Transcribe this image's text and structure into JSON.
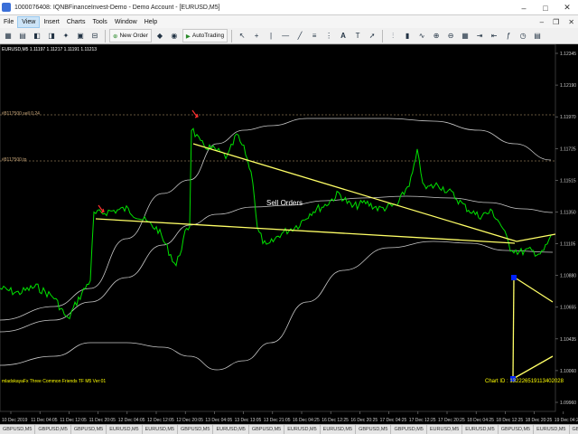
{
  "window": {
    "title": "1000076408: IQNBFinanceInvest-Demo - Demo Account - [EURUSD,M5]",
    "controls": [
      "–",
      "□",
      "✕"
    ]
  },
  "menu": {
    "items": [
      "File",
      "View",
      "Insert",
      "Charts",
      "Tools",
      "Window",
      "Help"
    ],
    "active": "View"
  },
  "toolbar": {
    "new_order": "New Order",
    "auto_trading": "AutoTrading"
  },
  "chart": {
    "symbol_info": "EURUSD,M5  1.11197 1.11217 1.11191 1.11213",
    "sell_level_label": "#8117500 sell 0.24",
    "tp_level_label": "#8117500 tp",
    "annotation": "Sell Orders",
    "indicator_label": "mladskayaFx Three Common Friends TF M5 Ver:01",
    "chart_id": "Chart ID : 132226519113402028",
    "price_ticks": [
      "1.12345",
      "1.12190",
      "1.11970",
      "1.11725",
      "1.11515",
      "1.11350",
      "1.11105",
      "1.10880",
      "1.10655",
      "1.10435",
      "1.10060",
      "1.09960"
    ],
    "time_ticks": [
      "10 Dec 2019",
      "11 Dec 04:05",
      "11 Dec 12:05",
      "11 Dec 20:05",
      "12 Dec 04:05",
      "12 Dec 12:05",
      "12 Dec 20:05",
      "13 Dec 04:05",
      "13 Dec 13:05",
      "13 Dec 21:05",
      "16 Dec 04:25",
      "16 Dec 12:25",
      "16 Dec 20:25",
      "17 Dec 04:25",
      "17 Dec 12:25",
      "17 Dec 20:25",
      "18 Dec 04:25",
      "18 Dec 12:25",
      "18 Dec 20:25",
      "19 Dec 04:25"
    ],
    "colors": {
      "background": "#000000",
      "price": "#00e000",
      "bands": "#c8c8c8",
      "trendlines": "#ffff66",
      "labels": "#ffff00",
      "markers": "#ff3030",
      "points": "#0022ff"
    }
  },
  "tabs": [
    "GBPUSD,M5",
    "GBPUSD,M5",
    "GBPUSD,M5",
    "EURUSD,M5",
    "EURUSD,M5",
    "GBPUSD,M5",
    "EURUSD,M5",
    "GBPUSD,M5",
    "EURUSD,M5",
    "EURUSD,M5",
    "GBPUSD,M5",
    "GBPUSD,M5",
    "EURUSD,M5",
    "EURUSD,M5",
    "GBPUSD,M5",
    "EURUSD,M5",
    "GBPUSD,M5",
    "EURUSD,M5",
    "EURUSD,M5"
  ]
}
